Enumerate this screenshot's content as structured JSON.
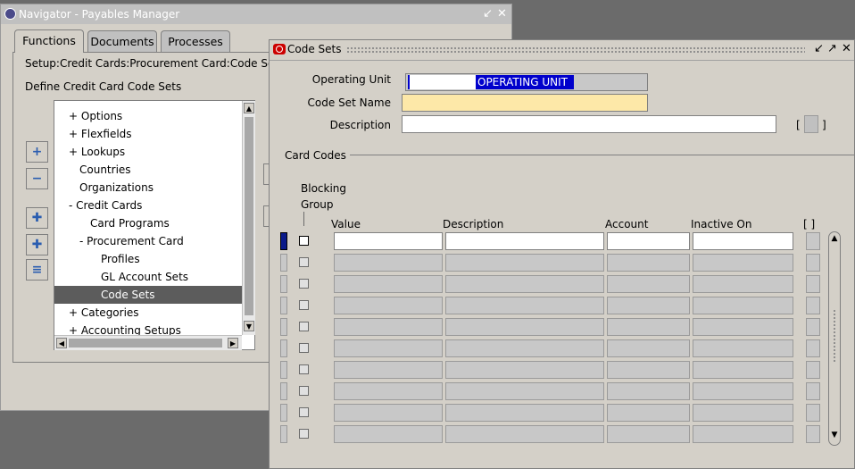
{
  "navigator": {
    "title": "Navigator - Payables Manager",
    "controls": [
      "↙",
      "✕"
    ],
    "tabs": [
      {
        "label": "Functions",
        "active": true
      },
      {
        "label": "Documents",
        "active": false
      },
      {
        "label": "Processes",
        "active": false
      }
    ],
    "path": "Setup:Credit Cards:Procurement Card:Code Se",
    "define": "Define Credit Card Code Sets",
    "tree": [
      {
        "label": "+  Options",
        "indent": 0
      },
      {
        "label": "+  Flexfields",
        "indent": 0
      },
      {
        "label": "+  Lookups",
        "indent": 0
      },
      {
        "label": "Countries",
        "indent": 1
      },
      {
        "label": "Organizations",
        "indent": 1
      },
      {
        "label": "-  Credit Cards",
        "indent": 0
      },
      {
        "label": "Card Programs",
        "indent": 2
      },
      {
        "label": "-  Procurement Card",
        "indent": 1
      },
      {
        "label": "Profiles",
        "indent": 3
      },
      {
        "label": "GL Account Sets",
        "indent": 3
      },
      {
        "label": "Code Sets",
        "indent": 3,
        "selected": true
      },
      {
        "label": "+  Categories",
        "indent": 0
      },
      {
        "label": "+  Accounting Setups",
        "indent": 0
      }
    ],
    "side_buttons": [
      {
        "name": "expand-button",
        "glyph": "+"
      },
      {
        "name": "collapse-button",
        "glyph": "−"
      },
      {
        "name": "expand-branch-button",
        "glyph": "✚"
      },
      {
        "name": "expand-all-button",
        "glyph": "✚"
      },
      {
        "name": "collapse-all-button",
        "glyph": "≡"
      }
    ]
  },
  "code_sets": {
    "title": "Code Sets",
    "controls": [
      "↙",
      "↗",
      "✕"
    ],
    "operating_unit_label": "Operating Unit",
    "operating_unit_value": "OPERATING UNIT",
    "code_set_name_label": "Code Set Name",
    "code_set_name_value": "",
    "description_label": "Description",
    "description_value": "",
    "dff_bracket_open": "[",
    "dff_bracket_close": "]",
    "card_codes_label": "Card Codes",
    "columns": {
      "blocking_group_1": "Blocking",
      "blocking_group_2": "Group",
      "value": "Value",
      "description": "Description",
      "account": "Account",
      "inactive_on": "Inactive On",
      "dff": "[ ]"
    },
    "row_count": 10
  },
  "colors": {
    "desktop": "#6b6b6b",
    "window_bg": "#d4d0c8",
    "required_field": "#fde8a8",
    "selection": "#0000cc",
    "tree_selected": "#5c5c5c"
  }
}
